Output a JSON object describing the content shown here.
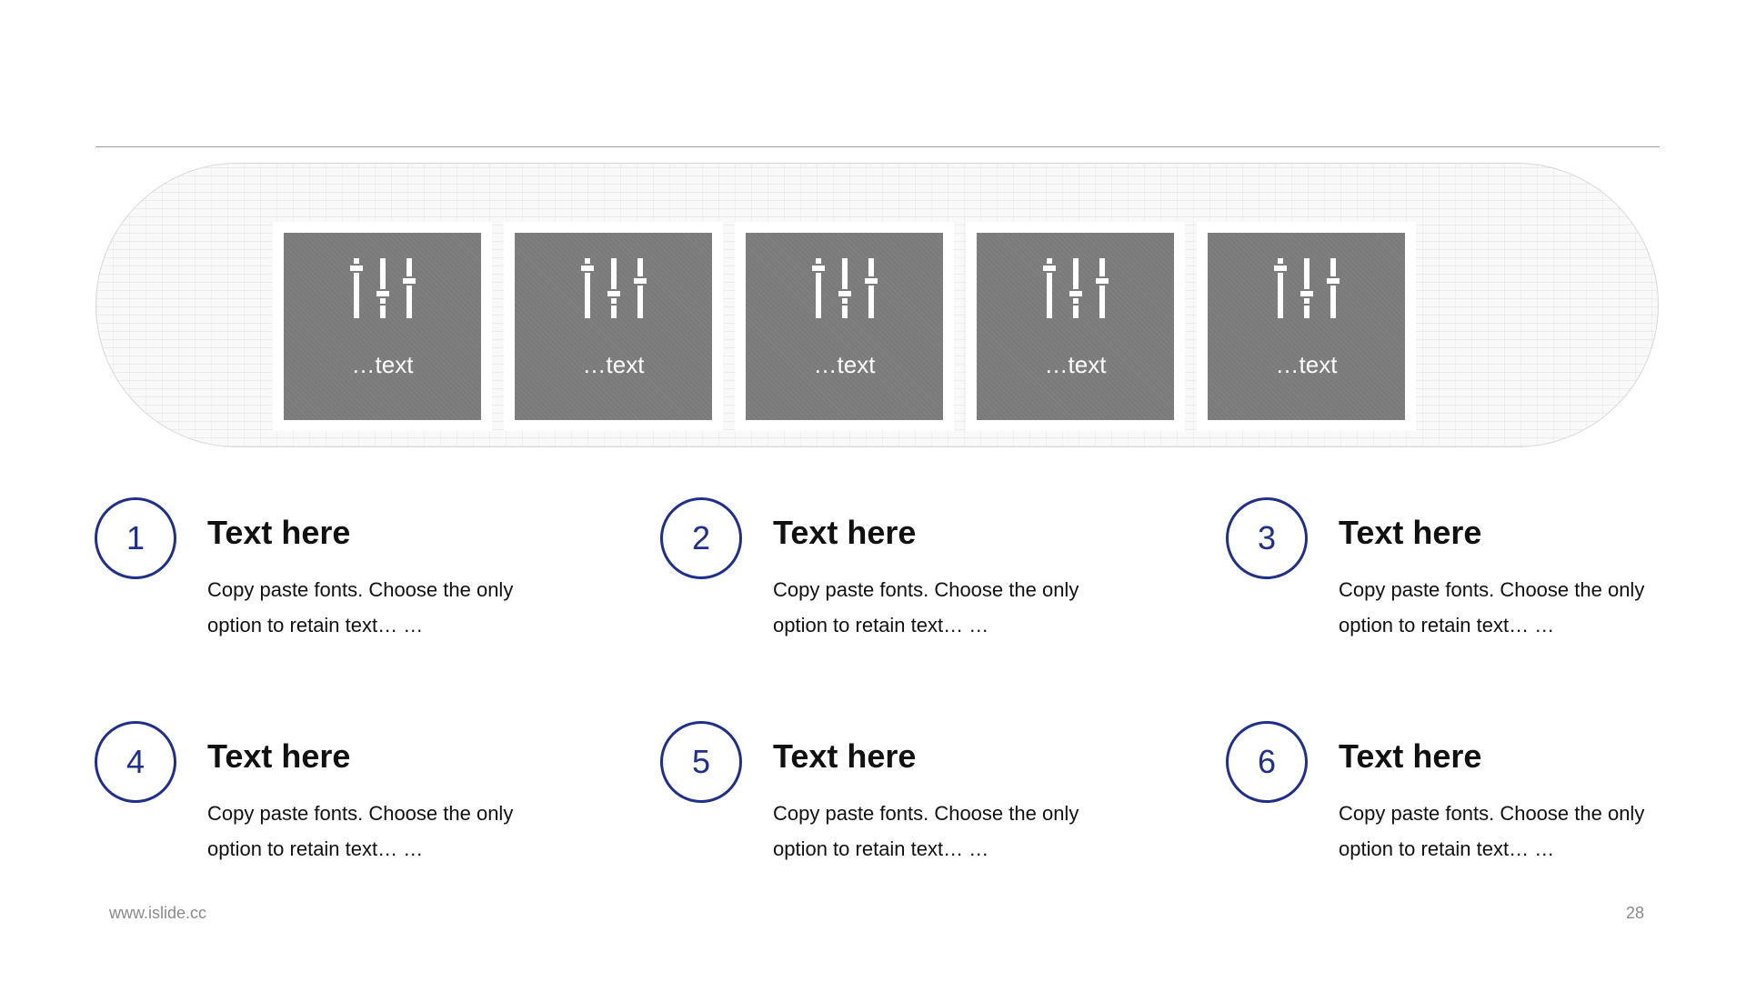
{
  "tiles": [
    {
      "label": "…text",
      "icon": "sliders-icon"
    },
    {
      "label": "…text",
      "icon": "sliders-icon"
    },
    {
      "label": "…text",
      "icon": "sliders-icon"
    },
    {
      "label": "…text",
      "icon": "sliders-icon"
    },
    {
      "label": "…text",
      "icon": "sliders-icon"
    }
  ],
  "items": [
    {
      "number": "1",
      "title": "Text here",
      "body": "Copy paste fonts. Choose the only option to retain text… …"
    },
    {
      "number": "2",
      "title": "Text here",
      "body": "Copy paste fonts. Choose the only option to retain text… …"
    },
    {
      "number": "3",
      "title": "Text here",
      "body": "Copy paste fonts. Choose the only option to retain text… …"
    },
    {
      "number": "4",
      "title": "Text here",
      "body": "Copy paste fonts. Choose the only option to retain text… …"
    },
    {
      "number": "5",
      "title": "Text here",
      "body": "Copy paste fonts. Choose the only option to retain text… …"
    },
    {
      "number": "6",
      "title": "Text here",
      "body": "Copy paste fonts. Choose the only option to retain text… …"
    }
  ],
  "footer": {
    "url": "www.islide.cc",
    "page": "28"
  },
  "colors": {
    "accent": "#1f2f8a",
    "tile": "#7b7b7b",
    "rule": "#9a9a9a"
  }
}
